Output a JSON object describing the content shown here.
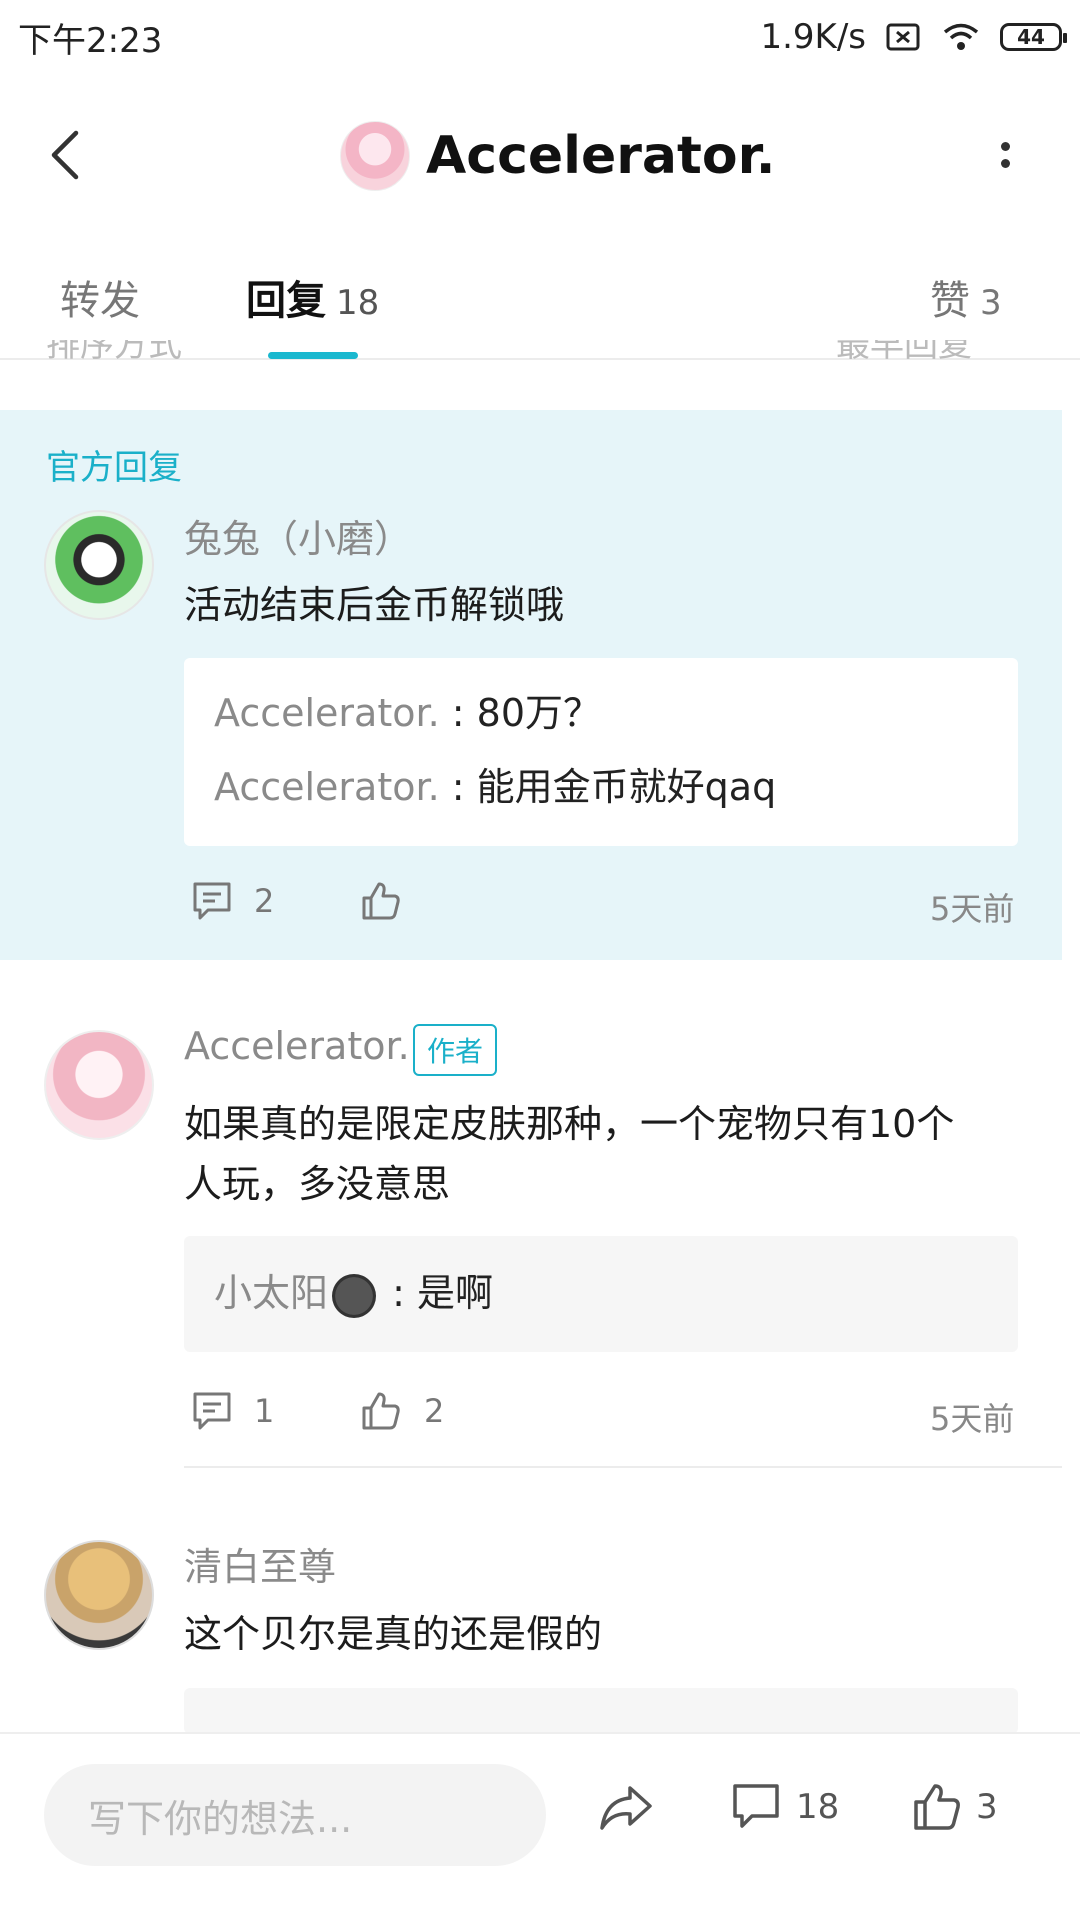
{
  "status_bar": {
    "time": "下午2:23",
    "speed": "1.9K/s",
    "battery": "44",
    "icons": [
      "sim-off-icon",
      "wifi-icon",
      "battery-icon"
    ]
  },
  "header": {
    "title": "Accelerator.",
    "icons": [
      "back-icon",
      "more-icon"
    ]
  },
  "tabs": [
    {
      "label": "转发",
      "count": ""
    },
    {
      "label": "回复",
      "count": "18"
    },
    {
      "label": "赞",
      "count": "3"
    }
  ],
  "sort_bar": {
    "left": "排序方式",
    "right": "最早回复"
  },
  "official_reply": {
    "section_label": "官方回复",
    "username": "兔兔（小磨）",
    "content": "活动结束后金币解锁哦",
    "replies": [
      {
        "user": "Accelerator.",
        "sep": " : ",
        "text": "80万？"
      },
      {
        "user": "Accelerator.",
        "sep": " : ",
        "text": "能用金币就好qaq"
      }
    ],
    "reply_count": "2",
    "like_count": "",
    "time": "5天前"
  },
  "comments": [
    {
      "username": "Accelerator.",
      "badge": "作者",
      "content_line1": "如果真的是限定皮肤那种，一个宠物只有10个",
      "content_line2": "人玩，多没意思",
      "reply_user": "小太阳",
      "reply_sep": " : ",
      "reply_text": "是啊",
      "reply_count": "1",
      "like_count": "2",
      "time": "5天前"
    },
    {
      "username": "清白至尊",
      "content": "这个贝尔是真的还是假的"
    }
  ],
  "bottom_bar": {
    "input_placeholder": "写下你的想法...",
    "comment_count": "18",
    "like_count": "3",
    "icons": [
      "share-icon",
      "comment-icon",
      "like-icon"
    ]
  },
  "colors": {
    "accent": "#1ab8cf",
    "official_bg": "#e6f5f9",
    "quote_bg": "#f6f6f6"
  }
}
